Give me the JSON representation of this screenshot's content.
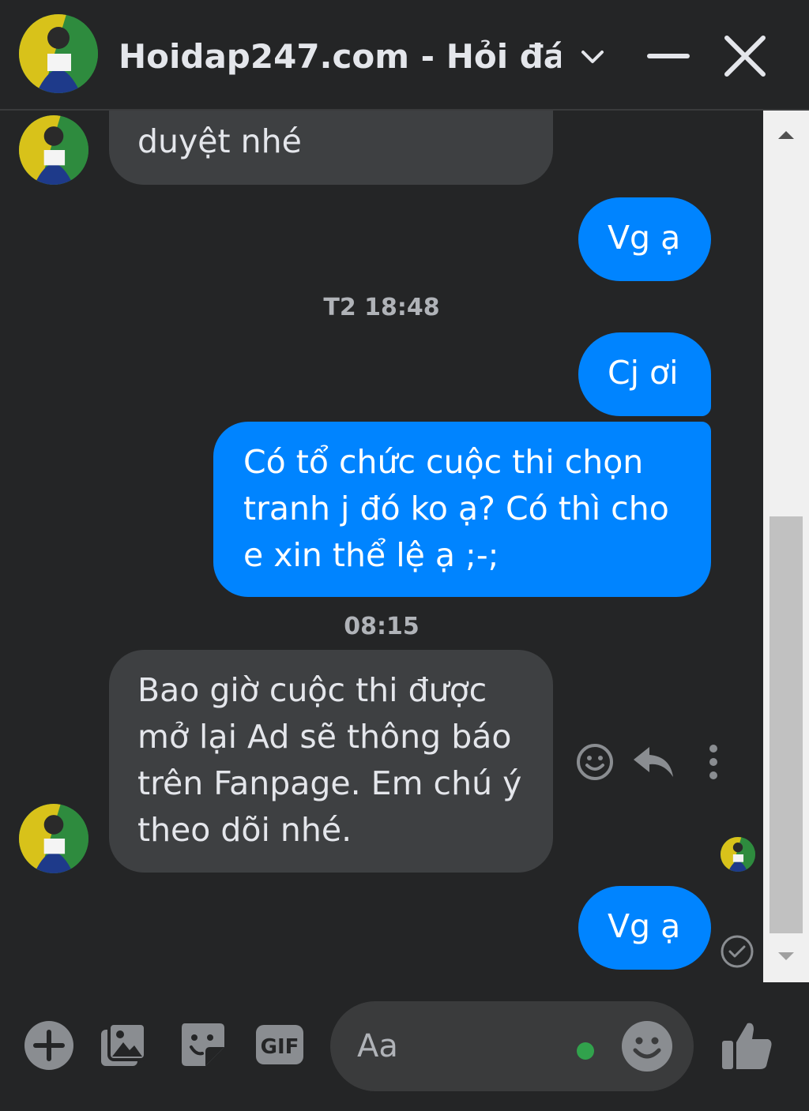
{
  "header": {
    "title": "Hoidap247.com - Hỏi đá..."
  },
  "messages": [
    {
      "direction": "incoming",
      "text": "duyệt nhé"
    },
    {
      "direction": "outgoing",
      "text": "Vg ạ"
    },
    {
      "type": "timestamp",
      "text": "T2 18:48"
    },
    {
      "direction": "outgoing",
      "text": "Cj ơi"
    },
    {
      "direction": "outgoing",
      "lines": [
        "Có tổ chức cuộc thi chọn",
        "tranh j đó ko ạ? Có thì cho",
        "e xin thể lệ ạ ;-;"
      ]
    },
    {
      "type": "timestamp",
      "text": "08:15"
    },
    {
      "direction": "incoming",
      "lines": [
        "Bao giờ cuộc thi được",
        "mở lại Ad sẽ thông báo",
        "trên Fanpage. Em chú ý",
        "theo dõi nhé."
      ]
    },
    {
      "direction": "outgoing",
      "text": "Vg ạ"
    }
  ],
  "composer": {
    "placeholder": "Aa",
    "gif_label": "GIF"
  },
  "colors": {
    "background": "#242526",
    "outgoing_bubble": "#0084ff",
    "incoming_bubble": "#3e4042",
    "active_dot": "#31a24c"
  },
  "icons": {
    "header": [
      "chevron-down-icon",
      "minimize-icon",
      "close-icon"
    ],
    "message_actions": [
      "emoji-react-icon",
      "reply-icon",
      "more-vertical-icon"
    ],
    "composer": [
      "plus-icon",
      "photo-icon",
      "sticker-icon",
      "gif-icon",
      "emoji-icon",
      "thumbs-up-icon"
    ],
    "status": [
      "seen-avatar",
      "sent-check-icon"
    ]
  }
}
